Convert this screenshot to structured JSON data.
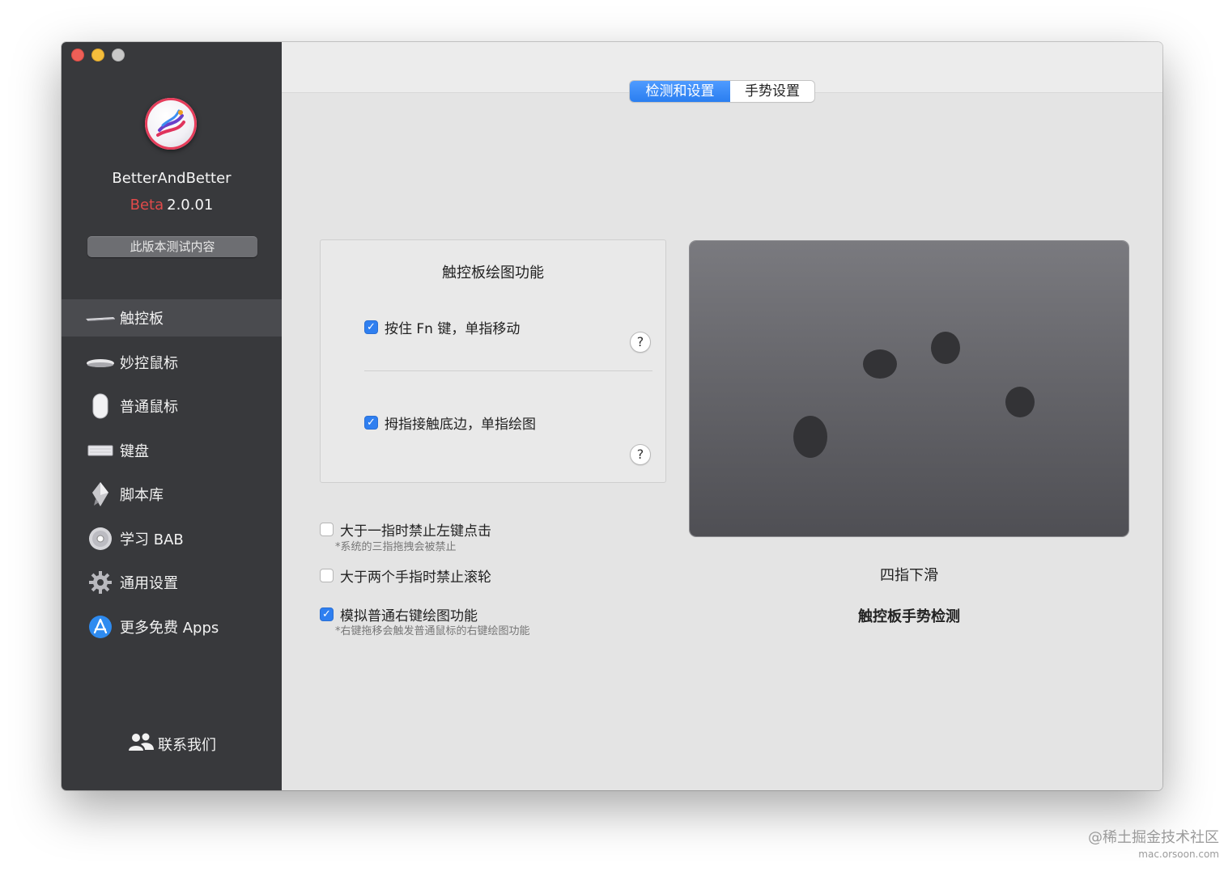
{
  "app": {
    "name": "BetterAndBetter",
    "beta_label": "Beta",
    "version": "2.0.01",
    "beta_button": "此版本测试内容"
  },
  "sidebar": {
    "items": [
      {
        "label": "触控板",
        "icon": "trackpad-icon",
        "active": true
      },
      {
        "label": "妙控鼠标",
        "icon": "magic-mouse-icon",
        "active": false
      },
      {
        "label": "普通鼠标",
        "icon": "mouse-icon",
        "active": false
      },
      {
        "label": "键盘",
        "icon": "keyboard-icon",
        "active": false
      },
      {
        "label": "脚本库",
        "icon": "script-icon",
        "active": false
      },
      {
        "label": "学习 BAB",
        "icon": "disc-icon",
        "active": false
      },
      {
        "label": "通用设置",
        "icon": "gear-icon",
        "active": false
      },
      {
        "label": "更多免费 Apps",
        "icon": "app-store-icon",
        "active": false
      }
    ],
    "contact": "联系我们"
  },
  "tabs": [
    {
      "label": "检测和设置",
      "active": true
    },
    {
      "label": "手势设置",
      "active": false
    }
  ],
  "panel": {
    "title": "触控板绘图功能",
    "options": [
      {
        "label": "按住 Fn 键，单指移动",
        "checked": true
      },
      {
        "label": "拇指接触底边，单指绘图",
        "checked": true
      }
    ],
    "help_label": "?"
  },
  "options": [
    {
      "label": "大于一指时禁止左键点击",
      "note": "*系统的三指拖拽会被禁止",
      "checked": false
    },
    {
      "label": "大于两个手指时禁止滚轮",
      "note": "",
      "checked": false
    },
    {
      "label": "模拟普通右键绘图功能",
      "note": "*右键拖移会触发普通鼠标的右键绘图功能",
      "checked": true
    }
  ],
  "gesture": {
    "name": "四指下滑",
    "title": "触控板手势检测"
  },
  "watermark": {
    "line1": "@稀土掘金技术社区",
    "line2": "mac.orsoon.com"
  },
  "colors": {
    "sidebar_bg": "#38393c",
    "accent": "#2f7ff0",
    "beta": "#e04a4a"
  }
}
